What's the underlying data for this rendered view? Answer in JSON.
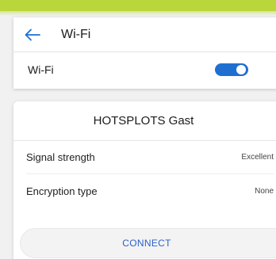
{
  "header": {
    "title": "Wi-Fi",
    "back_icon": "arrow-left-icon"
  },
  "wifi_toggle": {
    "label": "Wi-Fi",
    "state": "on",
    "color": "#1f6fd1"
  },
  "dialog": {
    "network_name": "HOTSPLOTS Gast",
    "rows": [
      {
        "label": "Signal strength",
        "value": "Excellent"
      },
      {
        "label": "Encryption type",
        "value": "None"
      }
    ],
    "connect_label": "CONNECT"
  },
  "colors": {
    "accent": "#b9d63a",
    "link": "#2a62c8"
  }
}
